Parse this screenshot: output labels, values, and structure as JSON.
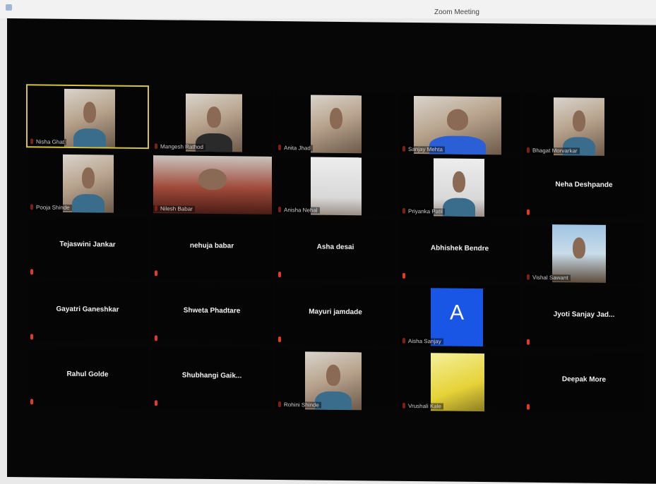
{
  "window": {
    "title": "Zoom Meeting"
  },
  "participants": [
    {
      "name": "Nisha Ghat",
      "video": true,
      "active": true
    },
    {
      "name": "Mangesh Rathod",
      "video": true
    },
    {
      "name": "Anita Jhad",
      "video": true
    },
    {
      "name": "Sanjay Mehta",
      "video": true
    },
    {
      "name": "Bhagat Morvarkar",
      "video": true
    },
    {
      "name": "Pooja Shinde",
      "video": true
    },
    {
      "name": "Nilesh Babar",
      "video": true
    },
    {
      "name": "Anisha Nehal",
      "video": true
    },
    {
      "name": "Priyanka Patil",
      "video": true
    },
    {
      "name": "Neha Deshpande",
      "video": false
    },
    {
      "name": "Tejaswini Jankar",
      "video": false
    },
    {
      "name": "nehuja babar",
      "video": false
    },
    {
      "name": "Asha desai",
      "video": false
    },
    {
      "name": "Abhishek Bendre",
      "video": false
    },
    {
      "name": "Vishal Sawant",
      "video": true
    },
    {
      "name": "Gayatri Ganeshkar",
      "video": false
    },
    {
      "name": "Shweta Phadtare",
      "video": false
    },
    {
      "name": "Mayuri jamdade",
      "video": false
    },
    {
      "name": "Aisha Sanjay",
      "video": true,
      "avatar_letter": "A"
    },
    {
      "name": "Jyoti  Sanjay  Jad...",
      "video": false
    },
    {
      "name": "Rahul Golde",
      "video": false
    },
    {
      "name": "Shubhangi  Gaik...",
      "video": false
    },
    {
      "name": "Rohini Shinde",
      "video": true
    },
    {
      "name": "Vrushali Kale",
      "video": true
    },
    {
      "name": "Deepak More",
      "video": false
    }
  ],
  "colors": {
    "background": "#060606",
    "active_border": "#d6c536",
    "muted_mic": "#e23b24",
    "avatar": "#1a56e6"
  }
}
